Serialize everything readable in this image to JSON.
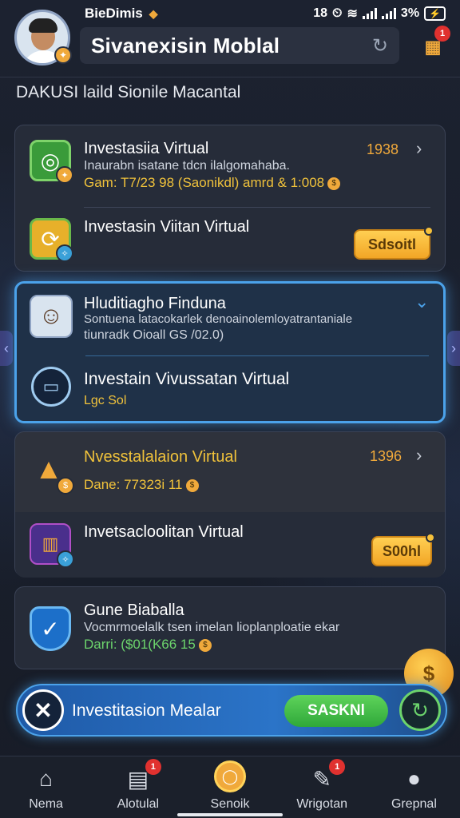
{
  "status_bar": {
    "app_name": "BieDimis",
    "time": "18",
    "battery": "3%"
  },
  "header": {
    "title": "Sivanexisin Moblal",
    "gift_badge": "1",
    "subheader": "DAKUSI laild Sionile Macantal"
  },
  "cards": {
    "card1": {
      "row1": {
        "title": "Investasiia Virtual",
        "desc": "Inaurabn isatane tdcn ilalgomahaba.",
        "earn": "Gam: T7/23 98 (Saonikdl) amrd & 1:008",
        "number": "1938"
      },
      "row2": {
        "title": "Investasin Viitan Virtual",
        "button": "Sdsoitl"
      }
    },
    "card2": {
      "row1": {
        "title": "Hluditiagho Finduna",
        "desc": "Sontuena latacokarlek denoainolemloyatrantaniale",
        "desc2": "tiunradk Oioall GS /02.0)"
      },
      "row2": {
        "title": "Investain Vivussatan Virtual",
        "desc": "Lgc Sol"
      }
    },
    "card3": {
      "row1": {
        "title": "Nvesstalalaion Virtual",
        "earn": "Dane: 77323i 11",
        "number": "1396"
      },
      "row2": {
        "title": "Invetsacloolitan Virtual",
        "button": "S00hl"
      }
    },
    "card4": {
      "title": "Gune Biaballa",
      "desc": "Vocmrmoelalk tsen imelan lioplanploatie ekar",
      "earn": "Darri: ($01(K66 15"
    }
  },
  "banner": {
    "text": "Investitasion Mealar",
    "button": "SASKNl"
  },
  "bottom_nav": {
    "items": [
      {
        "label": "Nema",
        "icon": "home-icon"
      },
      {
        "label": "Alotulal",
        "icon": "news-icon",
        "badge": "1"
      },
      {
        "label": "Senoik",
        "icon": "coin-icon"
      },
      {
        "label": "Wrigotan",
        "icon": "message-icon",
        "badge": "1"
      },
      {
        "label": "Grepnal",
        "icon": "profile-icon"
      }
    ]
  }
}
